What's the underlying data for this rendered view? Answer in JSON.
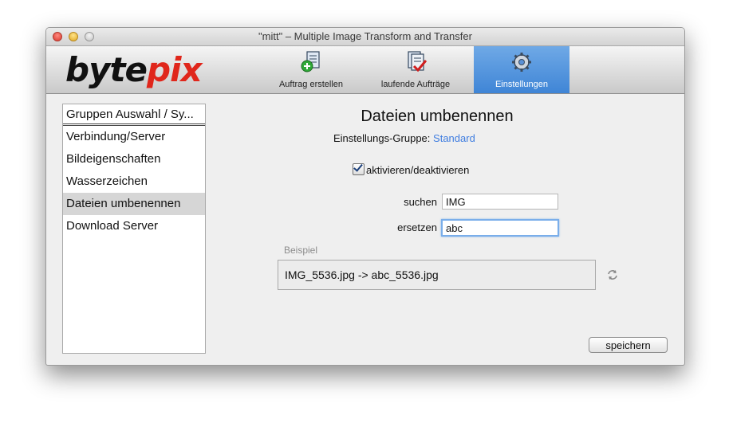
{
  "window": {
    "title": "\"mitt\" – Multiple Image Transform and Transfer"
  },
  "logo": {
    "part1": "byte",
    "part2": "pix"
  },
  "toolbar": {
    "items": [
      {
        "label": "Auftrag erstellen",
        "icon": "add-document-icon"
      },
      {
        "label": "laufende Aufträge",
        "icon": "checked-document-icon"
      },
      {
        "label": "Einstellungen",
        "icon": "gear-icon",
        "active": true
      }
    ]
  },
  "sidebar": {
    "header": "Gruppen Auswahl / Sy...",
    "items": [
      {
        "label": "Verbindung/Server"
      },
      {
        "label": "Bildeigenschaften"
      },
      {
        "label": "Wasserzeichen"
      },
      {
        "label": "Dateien umbenennen",
        "selected": true
      },
      {
        "label": "Download Server"
      }
    ]
  },
  "main": {
    "heading": "Dateien umbenennen",
    "group_label": "Einstellungs-Gruppe:",
    "group_value": "Standard",
    "toggle_label": "aktivieren/deaktivieren",
    "toggle_checked": true,
    "search_label": "suchen",
    "search_value": "IMG",
    "replace_label": "ersetzen",
    "replace_value": "abc",
    "example_label": "Beispiel",
    "example_text": "IMG_5536.jpg -> abc_5536.jpg",
    "save_label": "speichern"
  },
  "colors": {
    "accent": "#3f85d6",
    "link": "#3f7de0",
    "brand_red": "#e0261b"
  }
}
